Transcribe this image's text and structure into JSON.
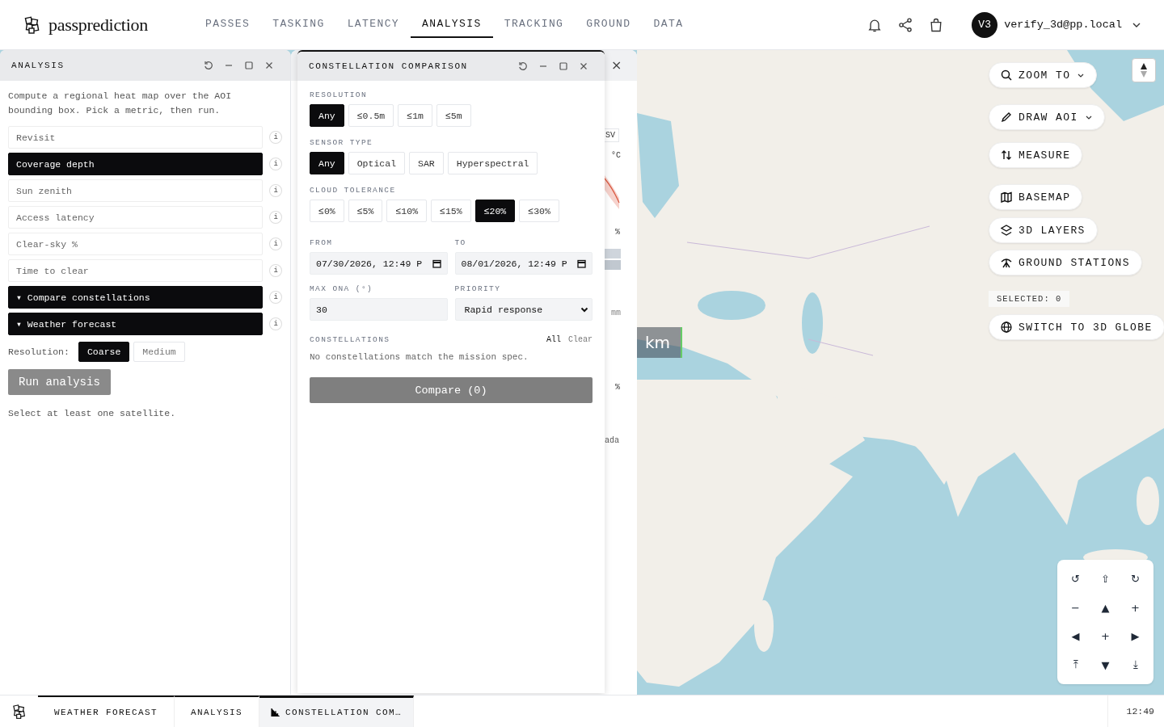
{
  "header": {
    "brand": "passprediction",
    "nav": [
      {
        "label": "PASSES",
        "selected": false
      },
      {
        "label": "TASKING",
        "selected": false
      },
      {
        "label": "LATENCY",
        "selected": false
      },
      {
        "label": "ANALYSIS",
        "selected": true
      },
      {
        "label": "TRACKING",
        "selected": false
      },
      {
        "label": "GROUND",
        "selected": false
      },
      {
        "label": "DATA",
        "selected": false
      }
    ],
    "user": {
      "initials": "V3",
      "email": "verify_3d@pp.local"
    }
  },
  "analysis_window": {
    "title": "ANALYSIS",
    "description": "Compute a regional heat map over the AOI bounding box. Pick a metric, then run.",
    "metrics": [
      {
        "label": "Revisit",
        "selected": false,
        "info": "i"
      },
      {
        "label": "Coverage depth",
        "selected": true,
        "info": "i"
      },
      {
        "label": "Sun zenith",
        "selected": false,
        "info": "i"
      },
      {
        "label": "Access latency",
        "selected": false,
        "info": "i"
      },
      {
        "label": "Clear-sky %",
        "selected": false,
        "info": "i"
      },
      {
        "label": "Time to clear",
        "selected": false,
        "info": "i"
      },
      {
        "label": "Compare constellations",
        "selected": true,
        "caret": "▾",
        "info": "i"
      },
      {
        "label": "Weather forecast",
        "selected": true,
        "caret": "▾",
        "info": "i"
      }
    ],
    "resolution_label": "Resolution:",
    "resolution_options": [
      {
        "label": "Coarse",
        "selected": true
      },
      {
        "label": "Medium",
        "selected": false
      }
    ],
    "run_button": {
      "label": "Run analysis",
      "disabled": true
    },
    "note": "Select at least one satellite."
  },
  "weather_window": {
    "close": "×",
    "fragments": [
      "SV",
      "°C",
      "%",
      "mm",
      "%",
      "ada"
    ]
  },
  "comparison_window": {
    "title": "CONSTELLATION COMPARISON",
    "sections": [
      {
        "label": "RESOLUTION",
        "options": [
          {
            "label": "Any",
            "selected": true
          },
          {
            "label": "≤0.5m",
            "selected": false
          },
          {
            "label": "≤1m",
            "selected": false
          },
          {
            "label": "≤5m",
            "selected": false
          }
        ]
      },
      {
        "label": "SENSOR TYPE",
        "options": [
          {
            "label": "Any",
            "selected": true
          },
          {
            "label": "Optical",
            "selected": false
          },
          {
            "label": "SAR",
            "selected": false
          },
          {
            "label": "Hyperspectral",
            "selected": false
          }
        ]
      },
      {
        "label": "CLOUD TOLERANCE",
        "options": [
          {
            "label": "≤0%",
            "selected": false
          },
          {
            "label": "≤5%",
            "selected": false
          },
          {
            "label": "≤10%",
            "selected": false
          },
          {
            "label": "≤15%",
            "selected": false
          },
          {
            "label": "≤20%",
            "selected": true
          },
          {
            "label": "≤30%",
            "selected": false
          }
        ]
      }
    ],
    "from": {
      "label": "FROM",
      "value": "07/30/2026, 12:49 P"
    },
    "to": {
      "label": "TO",
      "value": "08/01/2026, 12:49 P"
    },
    "max_ona": {
      "label": "MAX ONA (°)",
      "value": "30"
    },
    "priority": {
      "label": "PRIORITY",
      "value": "Rapid response"
    },
    "constellations": {
      "label": "CONSTELLATIONS",
      "actions": [
        "All",
        "Clear"
      ],
      "empty": "No constellations match the mission spec."
    },
    "compare_button": {
      "label": "Compare (0)",
      "disabled": true
    }
  },
  "map": {
    "scale_label": "km",
    "tools": [
      {
        "label": "ZOOM TO",
        "dropdown": true
      },
      {
        "label": "DRAW AOI",
        "dropdown": true
      },
      {
        "label": "MEASURE",
        "dropdown": false
      },
      {
        "label": "BASEMAP",
        "dropdown": false
      },
      {
        "label": "3D LAYERS",
        "dropdown": false
      },
      {
        "label": "GROUND STATIONS",
        "dropdown": false
      }
    ],
    "selected_count": "SELECTED: 0",
    "switch_button": "SWITCH TO 3D GLOBE",
    "nav_pad": [
      "↺",
      "⇧",
      "↻",
      "−",
      "▲",
      "+",
      "◀",
      "+",
      "▶",
      "⤒",
      "▼",
      "⤓"
    ]
  },
  "taskbar": {
    "tabs": [
      {
        "label": "WEATHER FORECAST",
        "selected": false
      },
      {
        "label": "ANALYSIS",
        "selected": false
      },
      {
        "label": "CONSTELLATION COM…",
        "selected": true
      }
    ],
    "clock": "12:49"
  }
}
